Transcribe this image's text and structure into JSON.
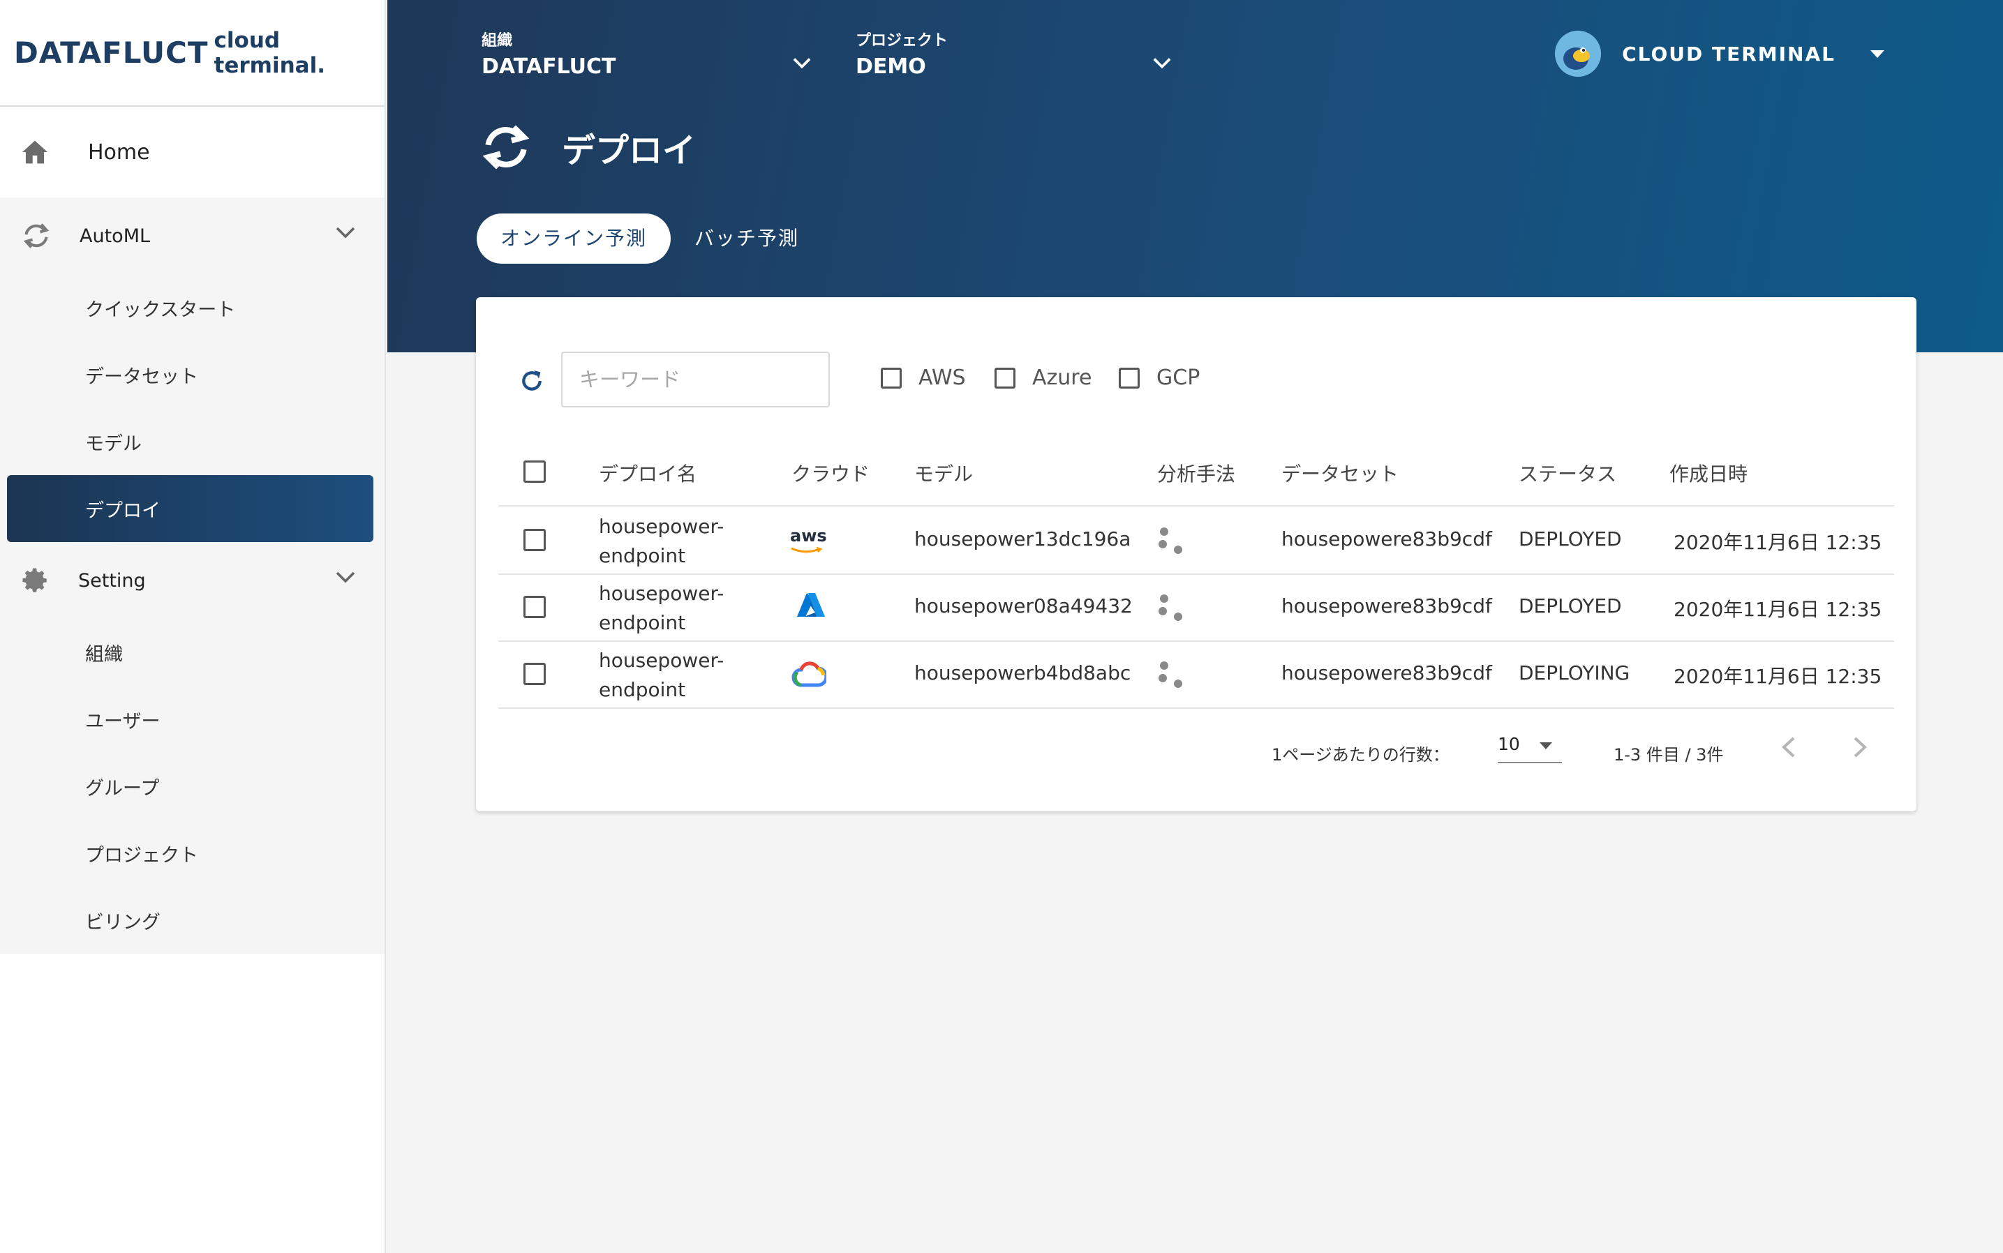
{
  "app": {
    "logo_main": "DATAFLUCT",
    "logo_sub": "cloud terminal."
  },
  "sidebar": {
    "home": "Home",
    "automl": {
      "label": "AutoML",
      "items": [
        "クイックスタート",
        "データセット",
        "モデル",
        "デプロイ"
      ],
      "active": "デプロイ"
    },
    "setting": {
      "label": "Setting",
      "items": [
        "組織",
        "ユーザー",
        "グループ",
        "プロジェクト",
        "ビリング"
      ]
    }
  },
  "header": {
    "org_caption": "組織",
    "org_value": "DATAFLUCT",
    "project_caption": "プロジェクト",
    "project_value": "DEMO",
    "user_name": "CLOUD TERMINAL"
  },
  "page": {
    "title": "デプロイ",
    "tabs": [
      "オンライン予測",
      "バッチ予測"
    ],
    "active_tab": "オンライン予測"
  },
  "filters": {
    "search_placeholder": "キーワード",
    "search_value": "",
    "clouds": [
      "AWS",
      "Azure",
      "GCP"
    ]
  },
  "table": {
    "columns": [
      "デプロイ名",
      "クラウド",
      "モデル",
      "分析手法",
      "データセット",
      "ステータス",
      "作成日時"
    ],
    "rows": [
      {
        "name_line1": "housepower-",
        "name_line2": "endpoint",
        "cloud": "aws",
        "cloud_label": "aws",
        "model": "housepower13dc196a",
        "method_icon": "clustering-icon",
        "dataset": "housepowere83b9cdf",
        "status": "DEPLOYED",
        "created": "2020年11月6日 12:35"
      },
      {
        "name_line1": "housepower-",
        "name_line2": "endpoint",
        "cloud": "azure",
        "cloud_label": "",
        "model": "housepower08a49432",
        "method_icon": "clustering-icon",
        "dataset": "housepowere83b9cdf",
        "status": "DEPLOYED",
        "created": "2020年11月6日 12:35"
      },
      {
        "name_line1": "housepower-",
        "name_line2": "endpoint",
        "cloud": "gcp",
        "cloud_label": "",
        "model": "housepowerb4bd8abc",
        "method_icon": "clustering-icon",
        "dataset": "housepowere83b9cdf",
        "status": "DEPLOYING",
        "created": "2020年11月6日 12:35"
      }
    ]
  },
  "pagination": {
    "rows_per_page_label": "1ページあたりの行数：",
    "rows_per_page": "10",
    "range": "1-3 件目 / 3件"
  },
  "colors": {
    "header_start": "#1e3859",
    "header_end": "#0e5a89",
    "accent": "#1d4e7d",
    "azure": "#0078d4"
  }
}
